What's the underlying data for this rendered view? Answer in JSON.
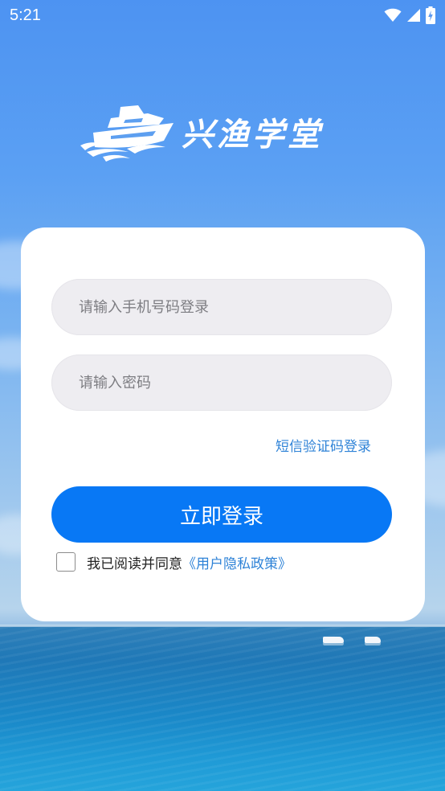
{
  "status_bar": {
    "time": "5:21",
    "icons": [
      "wifi-icon",
      "cellular-signal-icon",
      "battery-charging-icon"
    ]
  },
  "brand": {
    "logo_text": "兴渔学堂",
    "logo_icon": "yacht-icon"
  },
  "login_form": {
    "phone_placeholder": "请输入手机号码登录",
    "password_placeholder": "请输入密码",
    "sms_login_link": "短信验证码登录",
    "submit_label": "立即登录",
    "agreement": {
      "checked": false,
      "prefix": "我已阅读并同意",
      "policy_link": "《用户隐私政策》"
    }
  },
  "colors": {
    "primary_button": "#0878f5",
    "link": "#2f83d7",
    "input_background": "#eeedf1",
    "sky": "#4d93f2",
    "sea": "#1f78b7"
  }
}
